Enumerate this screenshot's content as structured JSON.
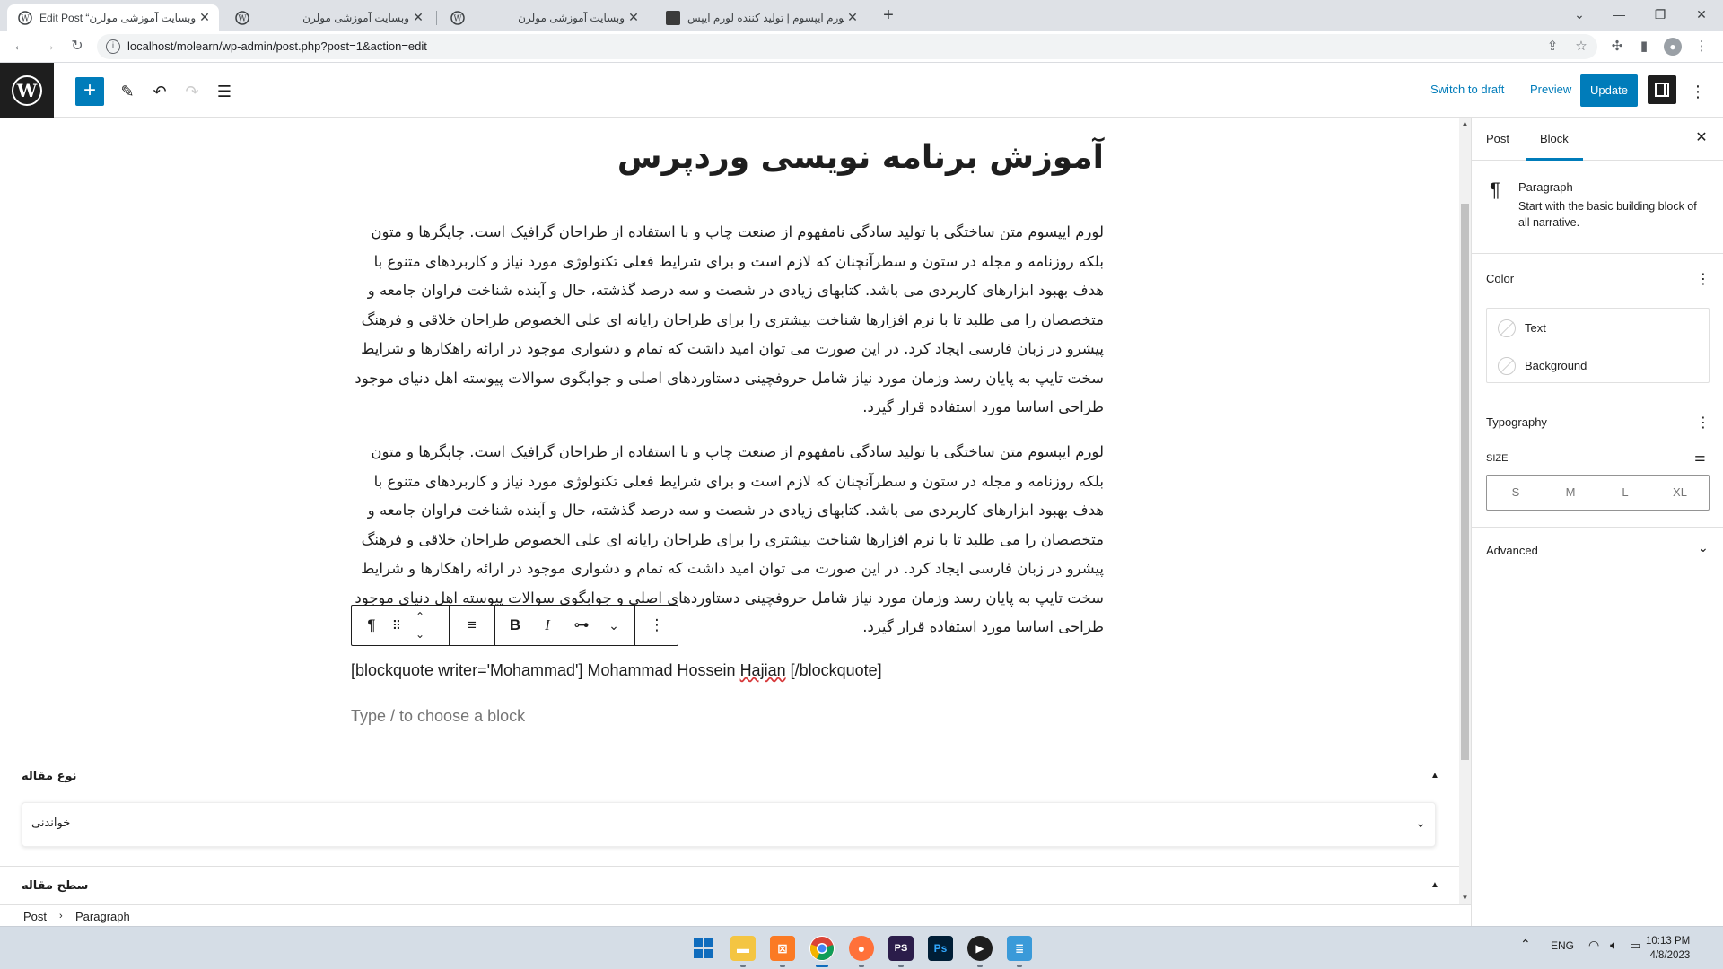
{
  "browser": {
    "tabs": [
      {
        "title": "Edit Post “وبسایت آموزشی مولرن”",
        "active": true
      },
      {
        "title": "وبسایت آموزشی مولرن",
        "active": false
      },
      {
        "title": "وبسایت آموزشی مولرن",
        "active": false
      },
      {
        "title": "لورم ایپسوم | تولید کننده لورم ایپس",
        "active": false
      }
    ],
    "url": "localhost/molearn/wp-admin/post.php?post=1&action=edit"
  },
  "header": {
    "switch_to_draft": "Switch to draft",
    "preview": "Preview",
    "update": "Update"
  },
  "post": {
    "title": "آموزش برنامه نویسی وردپرس",
    "paragraph_1": "لورم ایپسوم متن ساختگی با تولید سادگی نامفهوم از صنعت چاپ و با استفاده از طراحان گرافیک است. چاپگرها و متون بلکه روزنامه و مجله در ستون و سطرآنچنان که لازم است و برای شرایط فعلی تکنولوژی مورد نیاز و کاربردهای متنوع با هدف بهبود ابزارهای کاربردی می باشد. کتابهای زیادی در شصت و سه درصد گذشته، حال و آینده شناخت فراوان جامعه و متخصصان را می طلبد تا با نرم افزارها شناخت بیشتری را برای طراحان رایانه ای علی الخصوص طراحان خلاقی و فرهنگ پیشرو در زبان فارسی ایجاد کرد. در این صورت می توان امید داشت که تمام و دشواری موجود در ارائه راهکارها و شرایط سخت تایپ به پایان رسد وزمان مورد نیاز شامل حروفچینی دستاوردهای اصلی و جوابگوی سوالات پیوسته اهل دنیای موجود طراحی اساسا مورد استفاده قرار گیرد.",
    "paragraph_2": "لورم ایپسوم متن ساختگی با تولید سادگی نامفهوم از صنعت چاپ و با استفاده از طراحان گرافیک است. چاپگرها و متون بلکه روزنامه و مجله در ستون و سطرآنچنان که لازم است و برای شرایط فعلی تکنولوژی مورد نیاز و کاربردهای متنوع با هدف بهبود ابزارهای کاربردی می باشد. کتابهای زیادی در شصت و سه درصد گذشته، حال و آینده شناخت فراوان جامعه و متخصصان را می طلبد تا با نرم افزارها شناخت بیشتری را برای طراحان رایانه ای علی الخصوص طراحان خلاقی و فرهنگ پیشرو در زبان فارسی ایجاد کرد. در این صورت می توان امید داشت که تمام و دشواری موجود در ارائه راهکارها و شرایط سخت تایپ به پایان رسد وزمان مورد نیاز شامل حروفچینی دستاوردهای اصلی و جوابگوی سوالات پیوسته اهل دنیای موجود طراحی اساسا مورد استفاده قرار گیرد.",
    "shortcode_before": "[blockquote writer='Mohammad'] Mohammad Hossein ",
    "shortcode_misspelled": "Hajian",
    "shortcode_after": " [/blockquote]",
    "block_placeholder": "Type / to choose a block"
  },
  "meta_boxes": {
    "article_type_title": "نوع مقاله",
    "article_type_value": "خواندنی",
    "article_level_title": "سطح مقاله"
  },
  "breadcrumb": [
    "Post",
    "Paragraph"
  ],
  "sidebar": {
    "tab_post": "Post",
    "tab_block": "Block",
    "block_name": "Paragraph",
    "block_description": "Start with the basic building block of all narrative.",
    "color_title": "Color",
    "color_text": "Text",
    "color_background": "Background",
    "typography_title": "Typography",
    "size_label": "SIZE",
    "sizes": [
      "S",
      "M",
      "L",
      "XL"
    ],
    "advanced_title": "Advanced"
  },
  "taskbar": {
    "language": "ENG",
    "time": "10:13 PM",
    "date": "4/8/2023"
  },
  "colors": {
    "accent": "#007cba",
    "wp_dark": "#1e1e1e"
  }
}
